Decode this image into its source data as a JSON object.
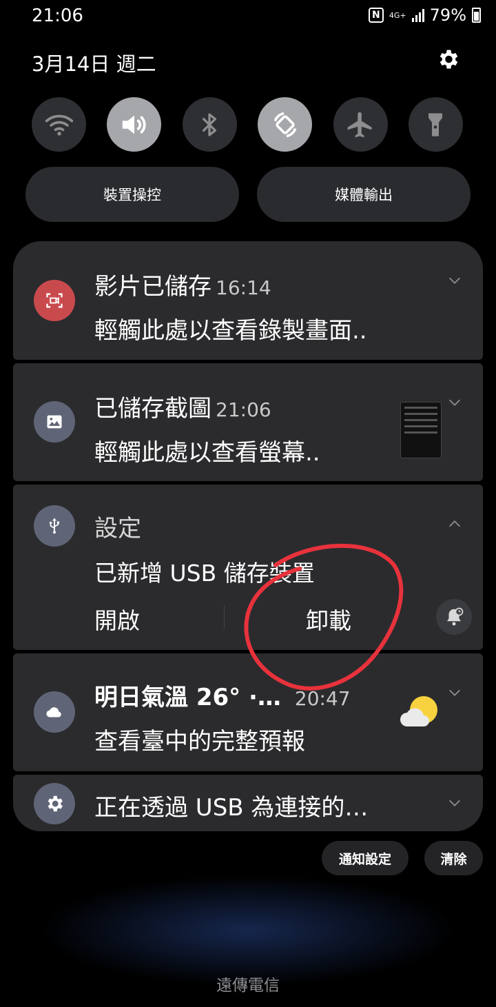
{
  "status_bar": {
    "time": "21:06",
    "network": "4G+",
    "battery": "79%"
  },
  "header": {
    "date": "3月14日 週二"
  },
  "quick_settings": [
    "wifi-icon",
    "sound-icon",
    "bluetooth-icon",
    "auto-rotate-icon",
    "airplane-icon",
    "flashlight-icon"
  ],
  "pills": {
    "device_control": "裝置操控",
    "media_output": "媒體輸出"
  },
  "notifications": {
    "video": {
      "title": "影片已儲存",
      "time": "16:14",
      "body": "輕觸此處以查看錄製畫面.."
    },
    "screenshot": {
      "title": "已儲存截圖",
      "time": "21:06",
      "body": "輕觸此處以查看螢幕.."
    },
    "usb_settings": {
      "title": "設定",
      "body": "已新增 USB 儲存裝置",
      "action_open": "開啟",
      "action_unmount": "卸載"
    },
    "weather": {
      "title": "明日氣溫 26° ·…",
      "time": "20:47",
      "body": "查看臺中的完整預報"
    },
    "usb_connection": {
      "title": "正在透過 USB 為連接的…"
    }
  },
  "footer": {
    "notification_settings": "通知設定",
    "clear": "清除",
    "carrier": "遠傳電信"
  },
  "colors": {
    "annotation": "#e8323c",
    "video_icon": "#c94a4d",
    "neutral_icon": "#5f6576",
    "card": "#2b2b2e"
  }
}
